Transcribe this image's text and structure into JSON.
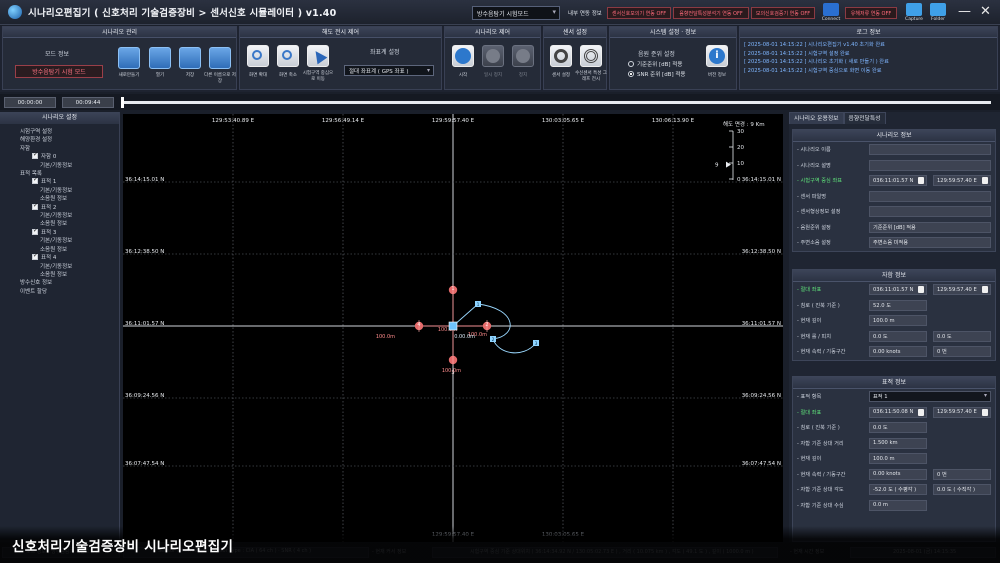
{
  "titlebar": {
    "title": "시나리오편집기 ( 신호처리 기술검증장비 > 센서신호 시뮬레이터 ) v1.40",
    "mode_select": "방수음탐기 시험모드",
    "internal_label": "내부 연동 정보",
    "btn_sensor_sim": "센서신호모의기 연동 OFF",
    "btn_sound": "음향전달특성분석기 연동 OFF",
    "btn_mocker": "모의신호검증기 연동 OFF",
    "btn_noise": "유해저류 연동 OFF",
    "icons": [
      {
        "name": "connect-icon",
        "label": "Connect",
        "color": "#2a6fd1"
      },
      {
        "name": "capture-icon",
        "label": "Capture",
        "color": "#3fa0e8"
      },
      {
        "name": "folder-icon",
        "label": "Folder",
        "color": "#3fa0e8"
      }
    ]
  },
  "toolbar": {
    "scenario_mgmt": {
      "title": "시나리오 관리",
      "mode_info": "모드 정보",
      "mode_button": "방수음탐기 시험 모드",
      "buttons": [
        "새로만들기",
        "열기",
        "저장",
        "다른 이름으로 저장"
      ]
    },
    "map_display": {
      "title": "해도 전시 제어",
      "buttons": [
        "화면 확대",
        "화면 축소",
        "시험구역 중심으로 이동"
      ],
      "coord_label": "좌표계 설정",
      "coord_value": "절대 좌표계 ( GPS 좌표 )"
    },
    "scenario_ctrl": {
      "title": "시나리오 제어",
      "buttons": [
        "시작",
        "일시 정지",
        "정지"
      ]
    },
    "sensor": {
      "title": "센서 설정",
      "buttons": [
        "센서 설정",
        "수신센서 특성 그래프 전시"
      ]
    },
    "system": {
      "title": "시스템 설정 · 정보",
      "sub": "음원 준위 설정",
      "radio1": "기준준위 [dB] 적용",
      "radio2": "SNR 준위 [dB] 적용",
      "version": "버전 정보",
      "selected": "SNR"
    },
    "log": {
      "title": "로그 정보",
      "lines": [
        "[ 2025-08-01 14:15:22 ] 시나리오편집기 v1.40 초기화 완료",
        "[ 2025-08-01 14:15:22 ] 시험구역 설정 완료",
        "[ 2025-08-01 14:15:22 ] 시나리오 초기화 ( 새로 만들기 ) 완료",
        "[ 2025-08-01 14:15:22 ] 시험구역 중심으로 화면 이동 완료"
      ]
    }
  },
  "timeline": {
    "start": "00:00:00",
    "end": "00:09:44",
    "progress": 0
  },
  "left_panel": {
    "title": "시나리오 설정",
    "items": [
      {
        "label": "시험구역 설정",
        "indent": 0,
        "check": false
      },
      {
        "label": "해양환경 설정",
        "indent": 0,
        "check": false
      },
      {
        "label": "자함",
        "indent": 0,
        "check": false
      },
      {
        "label": "자함 0",
        "indent": 1,
        "check": true
      },
      {
        "label": "기본/기동정보",
        "indent": 2,
        "check": false
      },
      {
        "label": "표적 목록",
        "indent": 0,
        "check": false
      },
      {
        "label": "표적 1",
        "indent": 1,
        "check": true
      },
      {
        "label": "기본/기동정보",
        "indent": 2,
        "check": false
      },
      {
        "label": "소음원 정보",
        "indent": 2,
        "check": false
      },
      {
        "label": "표적 2",
        "indent": 1,
        "check": true
      },
      {
        "label": "기본/기동정보",
        "indent": 2,
        "check": false
      },
      {
        "label": "소음원 정보",
        "indent": 2,
        "check": false
      },
      {
        "label": "표적 3",
        "indent": 1,
        "check": true
      },
      {
        "label": "기본/기동정보",
        "indent": 2,
        "check": false
      },
      {
        "label": "소음원 정보",
        "indent": 2,
        "check": false
      },
      {
        "label": "표적 4",
        "indent": 1,
        "check": true
      },
      {
        "label": "기본/기동정보",
        "indent": 2,
        "check": false
      },
      {
        "label": "소음원 정보",
        "indent": 2,
        "check": false
      },
      {
        "label": "방수신호 정보",
        "indent": 0,
        "check": false
      },
      {
        "label": "이벤트 할당",
        "indent": 0,
        "check": false
      }
    ]
  },
  "map": {
    "lon_labels": [
      "129:53:40.89 E",
      "129:56:49.14 E",
      "129:59:57.40 E",
      "130:03:05.65 E",
      "130:06:13.90 E"
    ],
    "lat_labels": [
      "36:14:15.01 N",
      "36:12:38.50 N",
      "36:11:01.57 N",
      "36:09:24.56 N",
      "36:07:47.54 N"
    ],
    "bottom_lon_labels": [
      "129:59:57.40 E",
      "130:03:05.65 E"
    ],
    "scale_title": "해도 면경 : 9 Km",
    "scale_ticks": [
      "30",
      "20",
      "10",
      "0"
    ],
    "scale_value": 9,
    "targets": [
      {
        "id": "1",
        "range": "100.0m"
      },
      {
        "id": "2",
        "range": "100.0m"
      },
      {
        "id": "3",
        "range": "100.0m"
      },
      {
        "id": "4",
        "range": "100.0m"
      }
    ],
    "own_ship_range": "0.00.0m",
    "waypoints": [
      "1",
      "2",
      "3"
    ]
  },
  "right_panel": {
    "tabs": [
      "시나리오 운용정보",
      "음향전달특성"
    ],
    "scenario_info": {
      "title": "시나리오 정보",
      "rows": [
        {
          "label": "- 시나리오 이름",
          "v1": "",
          "v2": "",
          "hl": false
        },
        {
          "label": "- 시나리오 설명",
          "v1": "",
          "v2": "",
          "hl": false
        },
        {
          "label": "- 시험구역 중심 좌표",
          "v1": "036:11:01.57 N",
          "v2": "129:59:57.40 E",
          "hl": true
        },
        {
          "label": "- 센서 파일명",
          "v1": "",
          "v2": "",
          "hl": false
        },
        {
          "label": "- 센서형상정보 설정",
          "v1": "",
          "v2": "",
          "hl": false
        },
        {
          "label": "- 음원준위 설정",
          "v1": "기준준위 [dB] 적용",
          "v2": "",
          "hl": false
        },
        {
          "label": "- 주변소음 설정",
          "v1": "주변소음 미적용",
          "v2": "",
          "hl": false
        }
      ]
    },
    "own_info": {
      "title": "자함 정보",
      "rows": [
        {
          "label": "- 절대 좌표",
          "v1": "036:11:01.57 N",
          "v2": "129:59:57.40 E",
          "hl": true
        },
        {
          "label": "- 침로 ( 진북 기준 )",
          "v1": "52.0 도",
          "v2": "",
          "hl": false
        },
        {
          "label": "- 현재 깊이",
          "v1": "100.0 m",
          "v2": "",
          "hl": false
        },
        {
          "label": "- 현재 롤 / 피치",
          "v1": "0.0 도",
          "v2": "0.0 도",
          "hl": false
        },
        {
          "label": "- 현재 속력 / 기동구간",
          "v1": "0.00 knots",
          "v2": "0 번",
          "hl": false
        }
      ]
    },
    "target_info": {
      "title": "표적 정보",
      "select_label": "- 표적 항목",
      "select_value": "표적 1",
      "rows": [
        {
          "label": "- 절대 좌표",
          "v1": "036:11:50.08 N",
          "v2": "129:59:57.40 E",
          "hl": true
        },
        {
          "label": "- 침로 ( 진북 기준 )",
          "v1": "0.0 도",
          "v2": "",
          "hl": false
        },
        {
          "label": "- 자함 기준 상대 거리",
          "v1": "1.500 km",
          "v2": "",
          "hl": false
        },
        {
          "label": "- 현재 깊이",
          "v1": "100.0 m",
          "v2": "",
          "hl": false
        },
        {
          "label": "- 현재 속력 / 기동구간",
          "v1": "0.00 knots",
          "v2": "0 번",
          "hl": false
        },
        {
          "label": "- 자함 기준 상대 각도",
          "v1": "-52.0 도 ( 수평각 )",
          "v2": "0.0 도 ( 수직각 )",
          "hl": false
        },
        {
          "label": "- 자함 기준 상대 수심",
          "v1": "0.0 m",
          "v2": "",
          "hl": false
        }
      ]
    }
  },
  "statusbar": {
    "mode": "모드 정보 ( 방수음탐기 시험모드 )",
    "sensor": "Sensor Information : Sensor Type : CIA ( 64 ch ) · SNR ( 4 ch )",
    "cursor_label": "- 현재 커서 정보",
    "cursor_value": "시험구역 중심 기준 상대위치 ( 36:14:34.92 N / 130:05:02.73 E ) , 거리 ( 10.075 km ) , 각도 ( 49.1 도 ) , 깊이 ( 1000.0 m )",
    "time_label": "- 현재 시간 정보",
    "time_value": "2025-08-01 (금) 14:15:35"
  },
  "caption": "신호처리기술검증장비 시나리오편집기"
}
